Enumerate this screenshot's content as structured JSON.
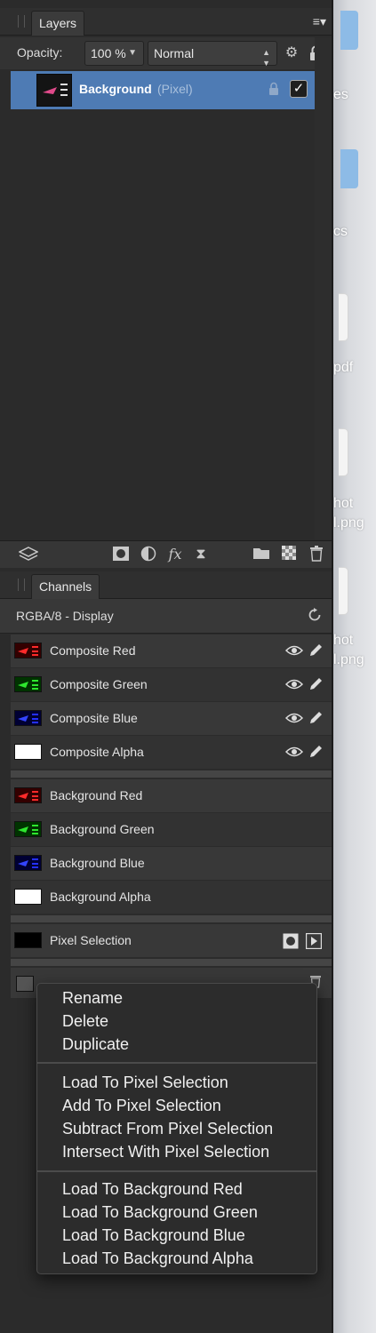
{
  "desktop": {
    "labels": [
      "es",
      "cs",
      "pdf",
      "hot",
      "l.png",
      "hot",
      "l.png"
    ]
  },
  "layers_panel": {
    "tab_label": "Layers",
    "opacity_label": "Opacity:",
    "opacity_value": "100 %",
    "blend_mode": "Normal",
    "layer": {
      "name": "Background",
      "type": "(Pixel)",
      "visible": true
    }
  },
  "channels_panel": {
    "tab_label": "Channels",
    "display_mode": "RGBA/8 - Display",
    "composite_channels": [
      {
        "label": "Composite Red",
        "thumb": "#ff2a2a"
      },
      {
        "label": "Composite Green",
        "thumb": "#2ee62e"
      },
      {
        "label": "Composite Blue",
        "thumb": "#2430ff"
      },
      {
        "label": "Composite Alpha",
        "thumb": "#ffffff"
      }
    ],
    "background_channels": [
      {
        "label": "Background Red",
        "thumb": "#ff2a2a"
      },
      {
        "label": "Background Green",
        "thumb": "#2ee62e"
      },
      {
        "label": "Background Blue",
        "thumb": "#2430ff"
      },
      {
        "label": "Background Alpha",
        "thumb": "#ffffff"
      }
    ],
    "pixel_selection": "Pixel Selection"
  },
  "context_menu": {
    "group1": [
      "Rename",
      "Delete",
      "Duplicate"
    ],
    "group2": [
      "Load To Pixel Selection",
      "Add To Pixel Selection",
      "Subtract From Pixel Selection",
      "Intersect With Pixel Selection"
    ],
    "group3": [
      "Load To Background Red",
      "Load To Background Green",
      "Load To Background Blue",
      "Load To Background Alpha"
    ]
  }
}
